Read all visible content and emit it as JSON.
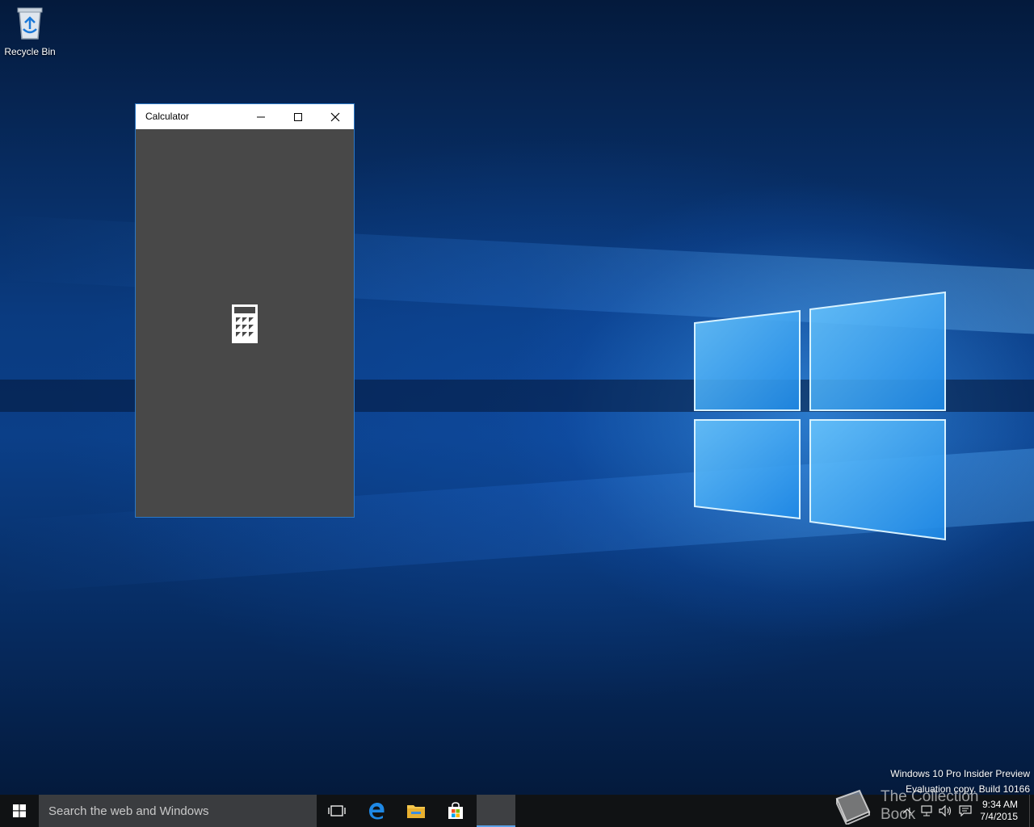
{
  "desktop": {
    "icons": [
      {
        "label": "Recycle Bin",
        "icon": "recycle-bin-icon"
      }
    ],
    "watermark": {
      "line1": "Windows 10 Pro Insider Preview",
      "line2": "Evaluation copy. Build 10166"
    },
    "overlay_logo_text": "The Collection Book"
  },
  "window": {
    "title": "Calculator",
    "splash_icon": "calculator-icon",
    "background_color": "#484848",
    "titlebar_color": "#ffffff",
    "border_color": "#2b78c6"
  },
  "taskbar": {
    "search_placeholder": "Search the web and Windows",
    "pinned": [
      {
        "name": "task-view",
        "icon": "task-view-icon"
      },
      {
        "name": "edge",
        "icon": "edge-icon"
      },
      {
        "name": "file-explorer",
        "icon": "folder-icon"
      },
      {
        "name": "store",
        "icon": "store-icon"
      },
      {
        "name": "calculator",
        "icon": "calculator-icon",
        "active": true
      }
    ],
    "tray": {
      "time": "9:34 AM",
      "date": "7/4/2015",
      "icons": [
        "chevron-up-icon",
        "network-icon",
        "volume-icon",
        "action-center-icon"
      ]
    },
    "accent_color": "#5aa0e8"
  }
}
